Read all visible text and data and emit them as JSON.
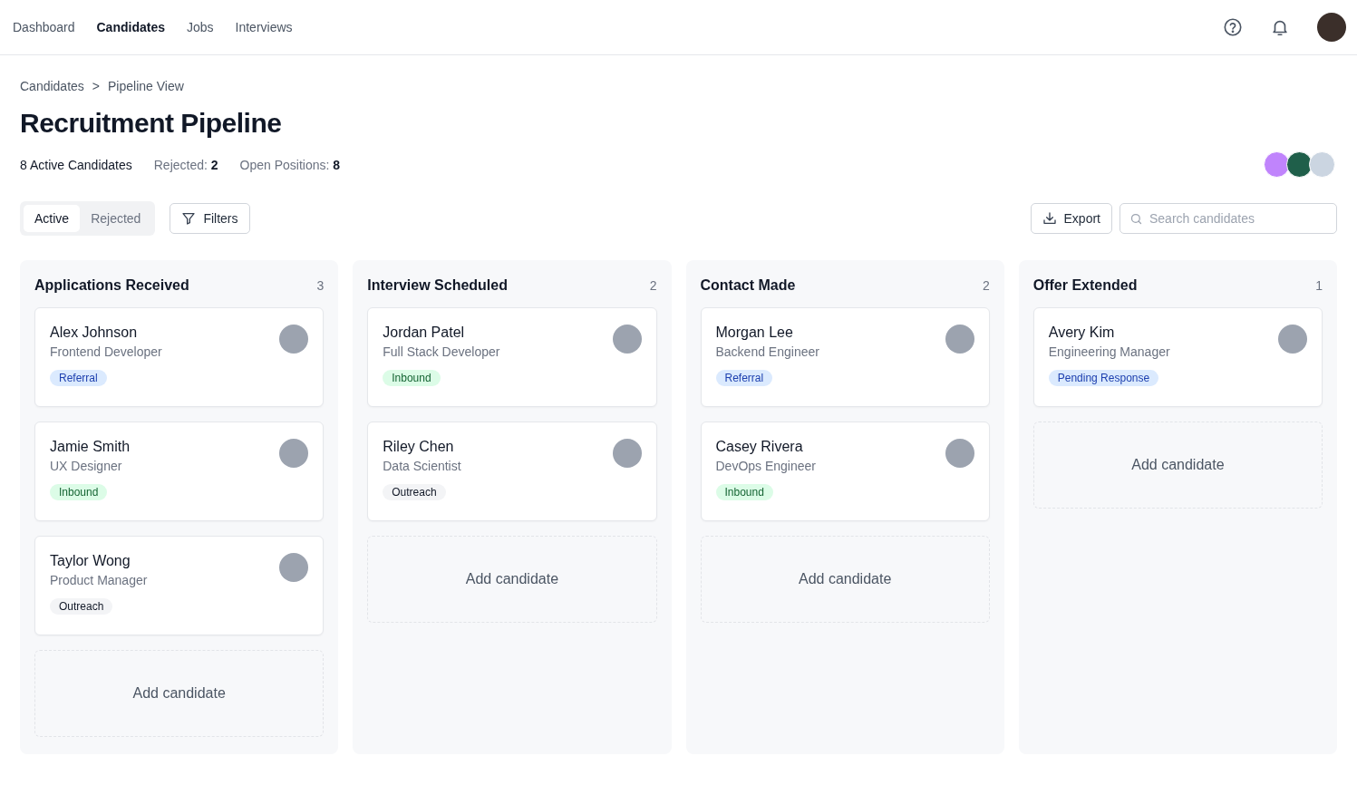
{
  "nav": {
    "items": [
      {
        "label": "Dashboard",
        "selected": false
      },
      {
        "label": "Candidates",
        "selected": true
      },
      {
        "label": "Jobs",
        "selected": false
      },
      {
        "label": "Interviews",
        "selected": false
      }
    ]
  },
  "breadcrumb": [
    "Candidates",
    "Pipeline View"
  ],
  "breadcrumb_separator": ">",
  "title": "Recruitment Pipeline",
  "stats": {
    "active": "8 Active Candidates",
    "rejected_label": "Rejected:",
    "rejected_value": "2",
    "open_label": "Open Positions:",
    "open_value": "8"
  },
  "view_tabs": [
    {
      "label": "Active",
      "selected": true
    },
    {
      "label": "Rejected",
      "selected": false
    }
  ],
  "filters_button": "Filters",
  "export_button": "Export",
  "search": {
    "placeholder": "Search candidates"
  },
  "columns": [
    {
      "title": "Applications Received",
      "count": "3",
      "add_label": "Add candidate",
      "cards": [
        {
          "name": "Alex Johnson",
          "role": "Frontend Developer",
          "tag": "Referral",
          "color": "#dbeafe"
        },
        {
          "name": "Jamie Smith",
          "role": "UX Designer",
          "tag": "Inbound",
          "color": "#dcfce7"
        },
        {
          "name": "Taylor Wong",
          "role": "Product Manager",
          "tag": "Outreach",
          "color": "#f3f4f6"
        }
      ]
    },
    {
      "title": "Interview Scheduled",
      "count": "2",
      "add_label": "Add candidate",
      "cards": [
        {
          "name": "Jordan Patel",
          "role": "Full Stack Developer",
          "tag": "Inbound",
          "color": "#dcfce7"
        },
        {
          "name": "Riley Chen",
          "role": "Data Scientist",
          "tag": "Outreach",
          "color": "#f3f4f6"
        }
      ]
    },
    {
      "title": "Contact Made",
      "count": "2",
      "add_label": "Add candidate",
      "cards": [
        {
          "name": "Morgan Lee",
          "role": "Backend Engineer",
          "tag": "Referral",
          "color": "#dbeafe"
        },
        {
          "name": "Casey Rivera",
          "role": "DevOps Engineer",
          "tag": "Inbound",
          "color": "#dcfce7"
        }
      ]
    },
    {
      "title": "Offer Extended",
      "count": "1",
      "add_label": "Add candidate",
      "cards": [
        {
          "name": "Avery Kim",
          "role": "Engineering Manager",
          "tag": "Pending Response",
          "color": "#dbeafe"
        }
      ]
    }
  ]
}
